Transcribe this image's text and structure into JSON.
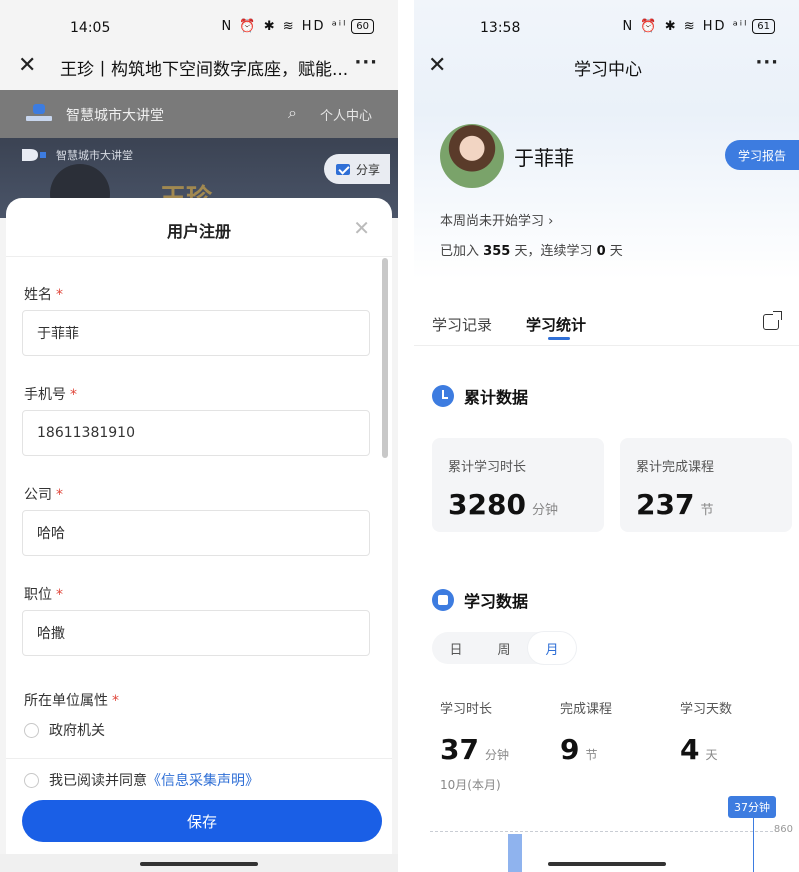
{
  "left": {
    "status": {
      "time": "14:05",
      "icons": "N ⏰ ✱ ≋ HD ᵃⁱˡ",
      "battery": "60"
    },
    "nav": {
      "title": "王珍丨构筑地下空间数字底座，赋能..."
    },
    "site": {
      "name": "智慧城市大讲堂",
      "personal": "个人中心"
    },
    "banner": {
      "name": "智慧城市大讲堂",
      "big": "王珍",
      "share": "分享"
    },
    "modal": {
      "title": "用户注册",
      "fields": [
        {
          "label": "姓名",
          "value": "于菲菲"
        },
        {
          "label": "手机号",
          "value": "18611381910"
        },
        {
          "label": "公司",
          "value": "哈哈"
        },
        {
          "label": "职位",
          "value": "哈撒"
        }
      ],
      "unit_attr": {
        "label": "所在单位属性",
        "option": "政府机关"
      },
      "agree": {
        "prefix": "我已阅读并同意",
        "link": "《信息采集声明》"
      },
      "save": "保存",
      "required_mark": "*"
    }
  },
  "right": {
    "status": {
      "time": "13:58",
      "icons": "N ⏰ ✱ ≋ HD ᵃⁱˡ",
      "battery": "61"
    },
    "nav": {
      "title": "学习中心"
    },
    "profile": {
      "name": "于菲菲",
      "report": "学习报告",
      "week": "本周尚未开始学习 ›",
      "joined_prefix": "已加入",
      "joined_days": "355",
      "joined_mid": "天，连续学习",
      "streak": "0",
      "joined_suffix": "天"
    },
    "tabs": {
      "record": "学习记录",
      "stats": "学习统计"
    },
    "cumulative": {
      "title": "累计数据",
      "time_label": "累计学习时长",
      "time_value": "3280",
      "time_unit": "分钟",
      "course_label": "累计完成课程",
      "course_value": "237",
      "course_unit": "节"
    },
    "study": {
      "title": "学习数据",
      "segments": [
        "日",
        "周",
        "月"
      ],
      "duration_label": "学习时长",
      "duration_value": "37",
      "duration_unit": "分钟",
      "courses_label": "完成课程",
      "courses_value": "9",
      "courses_unit": "节",
      "days_label": "学习天数",
      "days_value": "4",
      "days_unit": "天",
      "month": "10月(本月)",
      "tooltip": "37分钟",
      "ref_value": "860"
    }
  }
}
